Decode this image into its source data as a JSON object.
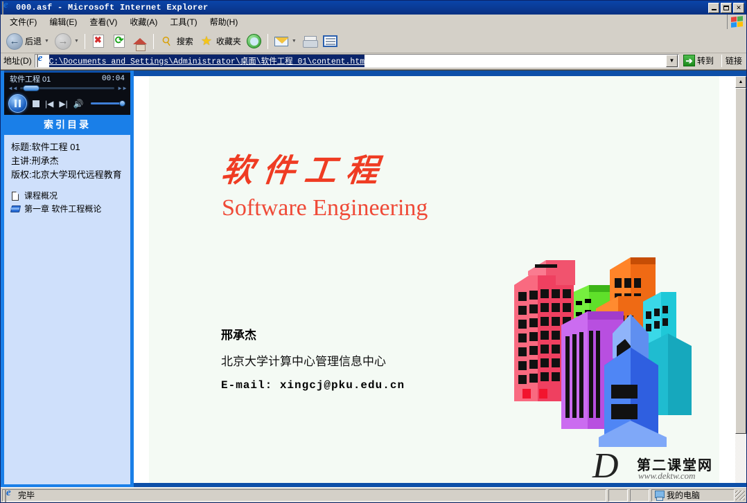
{
  "window": {
    "title": "000.asf - Microsoft Internet Explorer",
    "icon": "ie-icon",
    "minimize_label": "_",
    "maximize_label": "□",
    "close_label": "✕"
  },
  "menubar": {
    "items": [
      {
        "label": "文件(F)"
      },
      {
        "label": "编辑(E)"
      },
      {
        "label": "查看(V)"
      },
      {
        "label": "收藏(A)"
      },
      {
        "label": "工具(T)"
      },
      {
        "label": "帮助(H)"
      }
    ],
    "logo": "windows-logo"
  },
  "toolbar": {
    "back_label": "后退",
    "forward_label": "",
    "stop_label": "",
    "refresh_label": "",
    "home_label": "",
    "search_label": "搜索",
    "favorites_label": "收藏夹",
    "history_label": "",
    "mail_label": "",
    "print_label": "",
    "edit_label": ""
  },
  "address": {
    "label": "地址(D)",
    "value": "C:\\Documents and Settings\\Administrator\\桌面\\软件工程 01\\content.htm",
    "placeholder": "",
    "go_label": "转到",
    "links_label": "链接",
    "dropdown_glyph": "▼",
    "go_glyph": "➔"
  },
  "player": {
    "title": "软件工程 01",
    "time": "00:04",
    "pause_label": "pause",
    "stop_label": "stop",
    "prev_label": "previous",
    "next_label": "next",
    "volume_label": "volume"
  },
  "sidebar": {
    "index_header": "索引目录",
    "meta": [
      {
        "text": "标题:软件工程 01"
      },
      {
        "text": "主讲:刑承杰"
      },
      {
        "text": "版权:北京大学现代远程教育"
      }
    ],
    "toc": [
      {
        "icon": "document-icon",
        "label": "课程概况"
      },
      {
        "icon": "book-icon",
        "label": "第一章 软件工程概论"
      }
    ]
  },
  "slide": {
    "title_cn": "软件工程",
    "title_en": "Software Engineering",
    "author": "邢承杰",
    "affiliation": "北京大学计算中心管理信息中心",
    "email": "E-mail: xingcj@pku.edu.cn",
    "background_color": "#f4faf4",
    "title_color": "#ef3c23"
  },
  "watermark": {
    "logo_letter": "D",
    "site_name": "第二课堂网",
    "url": "www.dektw.com"
  },
  "scrollbar": {
    "up_glyph": "▲",
    "down_glyph": "▼"
  },
  "statusbar": {
    "message": "完毕",
    "zone": "我的电脑"
  }
}
